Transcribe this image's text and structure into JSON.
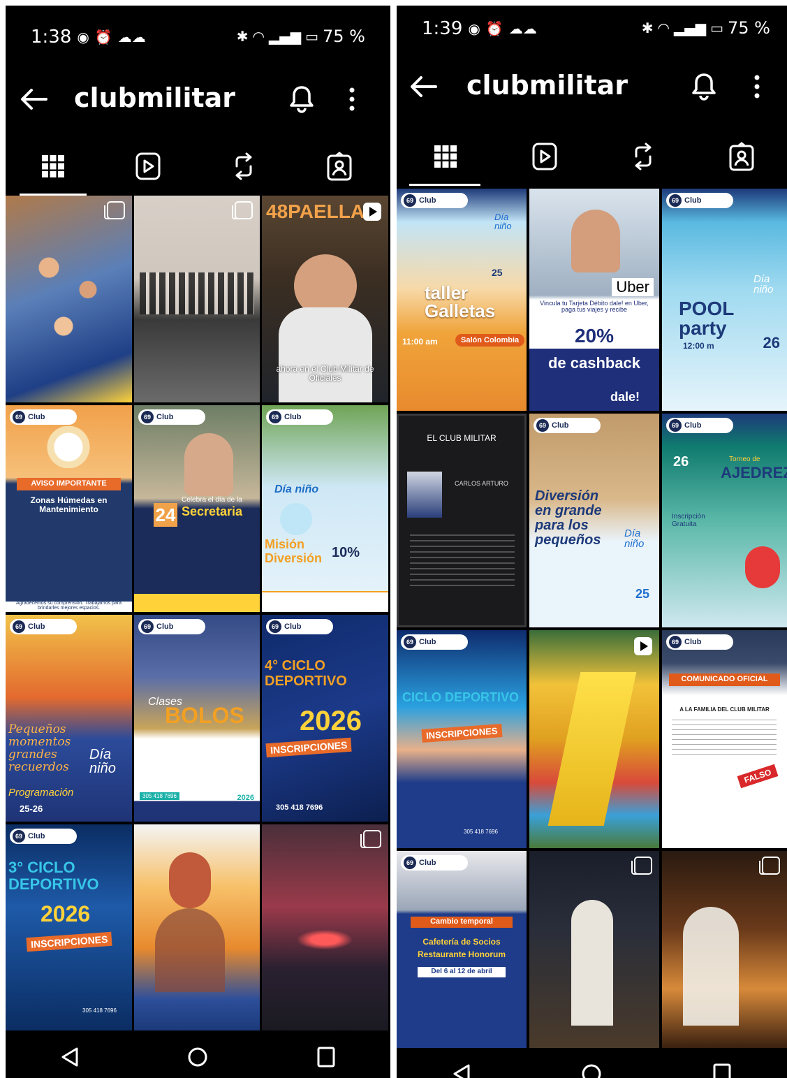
{
  "left": {
    "status": {
      "time": "1:38",
      "battery": "75 %"
    },
    "username": "clubmilitar",
    "tiles": [
      {
        "caption": ""
      },
      {
        "caption": ""
      },
      {
        "caption": "ahora en el Club Militar de Oficiales",
        "title": "48PAELLAS"
      },
      {
        "caption": "Zonas Húmedas en Mantenimiento",
        "title": "AVISO IMPORTANTE",
        "footer": "Agradecemos su comprensión. Trabajamos para brindarles mejores espacios."
      },
      {
        "caption": "Secretaria",
        "title": "Celebra el día de la",
        "day": "24"
      },
      {
        "caption": "Misión Diversión",
        "title": "Día niño",
        "pct": "10%"
      },
      {
        "caption": "Pequeños momentos grandes recuerdos",
        "title": "Día niño",
        "sub": "Programación",
        "date": "25-26"
      },
      {
        "caption": "BOLOS",
        "title": "Clases",
        "year": "2026",
        "phone": "305 418 7696"
      },
      {
        "caption": "INSCRIPCIONES",
        "title": "4° CICLO DEPORTIVO",
        "year": "2026",
        "phone": "305 418 7696"
      },
      {
        "caption": "INSCRIPCIONES",
        "title": "3° CICLO DEPORTIVO",
        "year": "2026",
        "phone": "305 418 7696"
      },
      {
        "caption": ""
      },
      {
        "caption": ""
      }
    ]
  },
  "right": {
    "status": {
      "time": "1:39",
      "battery": "75 %"
    },
    "username": "clubmilitar",
    "tiles": [
      {
        "caption": "taller Galletas",
        "title": "Día niño",
        "time": "11:00 am",
        "place": "Salón Colombia",
        "date": "25"
      },
      {
        "caption": "de cashback",
        "title": "Uber",
        "pct": "20%",
        "brand": "dale!",
        "sub": "Vincula tu Tarjeta Débito dale! en Uber, paga tus viajes y recibe"
      },
      {
        "caption": "POOL party",
        "title": "Día niño",
        "time": "12:00 m",
        "date": "26"
      },
      {
        "caption": "EL CLUB MILITAR",
        "title": "CARLOS ARTURO"
      },
      {
        "caption": "Diversión en grande para los pequeños",
        "title": "Día niño",
        "date": "25"
      },
      {
        "caption": "AJEDREZ",
        "title": "Torneo de",
        "date": "26",
        "sub": "Inscripción Gratuita"
      },
      {
        "caption": "INSCRIPCIONES",
        "title": "CICLO DEPORTIVO",
        "phone": "305 418 7696"
      },
      {
        "caption": ""
      },
      {
        "caption": "A LA FAMILIA DEL CLUB MILITAR",
        "title": "COMUNICADO OFICIAL",
        "stamp": "FALSO"
      },
      {
        "caption": "Cafetería de Socios",
        "title": "Cambio temporal",
        "sub": "Restaurante Honorum",
        "date": "Del 6 al 12 de abril"
      },
      {
        "caption": ""
      },
      {
        "caption": ""
      }
    ]
  },
  "colors": {
    "bg": "#000000",
    "fg": "#ffffff",
    "navy": "#1a2a55",
    "orange": "#f08a1c",
    "yellow": "#ffd23a"
  }
}
